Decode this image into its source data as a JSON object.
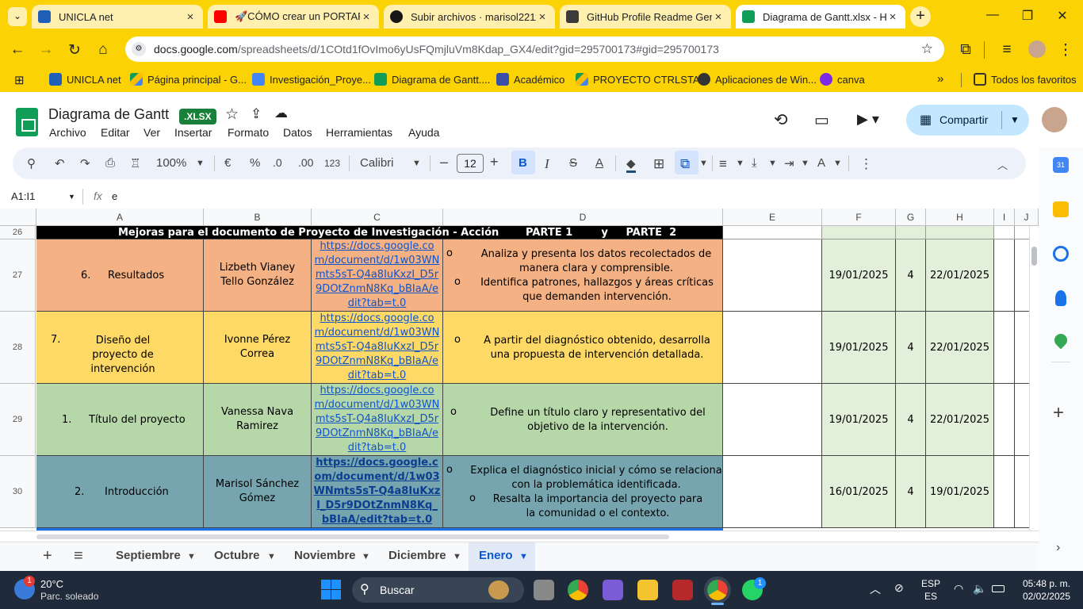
{
  "browser": {
    "tabs": [
      {
        "title": "UNICLA net",
        "color": "#1f5fb8"
      },
      {
        "title": "🚀CÓMO crear un PORTAFOLI",
        "color": "#ff0000"
      },
      {
        "title": "Subir archivos · marisol2211",
        "color": "#181717"
      },
      {
        "title": "GitHub Profile Readme Gene",
        "color": "#3b3b3b"
      },
      {
        "title": "Diagrama de Gantt.xlsx - Hoj",
        "color": "#0f9d58"
      }
    ],
    "url_host": "docs.google.com",
    "url_path": "/spreadsheets/d/1COtd1fOvImo6yUsFQmjluVm8Kdap_GX4/edit?gid=295700173#gid=295700173",
    "bookmarks": [
      "UNICLA net",
      "Página principal - G...",
      "Investigación_Proye...",
      "Diagrama de Gantt....",
      "Académico",
      "PROYECTO CTRLSTA...",
      "Aplicaciones de Win...",
      "canva"
    ],
    "all_favorites": "Todos los favoritos"
  },
  "sheets": {
    "title": "Diagrama de Gantt",
    "badge": ".XLSX",
    "menus": [
      "Archivo",
      "Editar",
      "Ver",
      "Insertar",
      "Formato",
      "Datos",
      "Herramientas",
      "Ayuda"
    ],
    "share_label": "Compartir",
    "toolbar": {
      "zoom": "100%",
      "currency": "€",
      "percent": "%",
      "dec_less": ".0",
      "dec_more": ".00",
      "number_format": "123",
      "font": "Calibri",
      "font_size": "12"
    },
    "name_box": "A1:I1",
    "formula_value": "e",
    "columns": [
      "A",
      "B",
      "C",
      "D",
      "E",
      "F",
      "G",
      "H",
      "I",
      "J"
    ],
    "header_row": {
      "num": "26",
      "title": "Mejoras para el documento de Proyecto de Investigación - Acción",
      "part": "PARTE 1        y     PARTE  2"
    },
    "rows": [
      {
        "num": "27",
        "section_num": "6.",
        "section": "Resultados",
        "person": "Lizbeth Vianey Tello González",
        "link": "https://docs.google.com/document/d/1w03WNmts5sT-Q4a8IuKxzI_D5r9DOtZnmN8Kq_bBIaA/edit?tab=t.0",
        "items": [
          "Analiza y presenta los datos recolectados de manera clara y comprensible.",
          "Identifica patrones, hallazgos y áreas críticas que demanden intervención."
        ],
        "start": "19/01/2025",
        "days": "4",
        "end": "22/01/2025",
        "color": "#f4b183"
      },
      {
        "num": "28",
        "section_num": "7.",
        "section": "Diseño del proyecto de intervención",
        "person": "Ivonne Pérez Correa",
        "link": "https://docs.google.com/document/d/1w03WNmts5sT-Q4a8IuKxzI_D5r9DOtZnmN8Kq_bBIaA/edit?tab=t.0",
        "items": [
          "A partir del diagnóstico obtenido, desarrolla una propuesta de intervención detallada."
        ],
        "start": "19/01/2025",
        "days": "4",
        "end": "22/01/2025",
        "color": "#ffd966"
      },
      {
        "num": "29",
        "section_num": "1.",
        "section": "Título del proyecto",
        "person": "Vanessa Nava Ramirez",
        "link": "https://docs.google.com/document/d/1w03WNmts5sT-Q4a8IuKxzI_D5r9DOtZnmN8Kq_bBIaA/edit?tab=t.0",
        "items": [
          "Define un título claro y representativo del objetivo de la intervención."
        ],
        "start": "19/01/2025",
        "days": "4",
        "end": "22/01/2025",
        "color": "#b6d7a8"
      },
      {
        "num": "30",
        "section_num": "2.",
        "section": "Introducción",
        "person": "Marisol Sánchez Gómez",
        "link": "https://docs.google.com/document/d/1w03WNmts5sT-Q4a8IuKxzI_D5r9DOtZnmN8Kq_bBIaA/edit?tab=t.0",
        "items": [
          "Explica el diagnóstico inicial y cómo se relaciona con la problemática identificada.",
          "Resalta la importancia del proyecto para la comunidad o el contexto."
        ],
        "start": "16/01/2025",
        "days": "4",
        "end": "19/01/2025",
        "color": "#76a5af"
      }
    ],
    "bullet": "o",
    "date_col_color": "#e2efda",
    "sheet_tabs": [
      "Septiembre",
      "Octubre",
      "Noviembre",
      "Diciembre",
      "Enero"
    ],
    "active_tab": "Enero"
  },
  "taskbar": {
    "weather_temp": "20°C",
    "weather_desc": "Parc. soleado",
    "weather_badge": "1",
    "search_placeholder": "Buscar",
    "lang_top": "ESP",
    "lang_bottom": "ES",
    "time": "05:48 p. m.",
    "date": "02/02/2025",
    "whatsapp_badge": "1"
  }
}
